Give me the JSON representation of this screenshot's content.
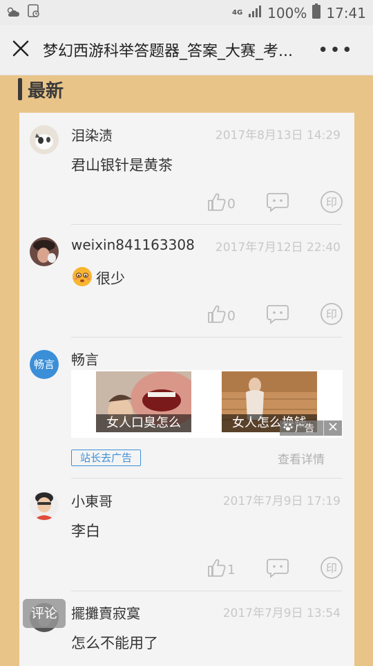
{
  "status_bar": {
    "network": "4G",
    "battery": "100%",
    "time": "17:41"
  },
  "navbar": {
    "title": "梦幻西游科举答题器_答案_大赛_考...",
    "more_label": "•••"
  },
  "section": {
    "title": "最新"
  },
  "comments": [
    {
      "username": "泪染渍",
      "time": "2017年8月13日 14:29",
      "text": "君山银针是黄茶",
      "likes": "0",
      "emoji": false
    },
    {
      "username": "weixin841163308",
      "time": "2017年7月12日 22:40",
      "text": "很少",
      "likes": "0",
      "emoji": true
    },
    {
      "username": "小東哥",
      "time": "2017年7月9日 17:19",
      "text": "李白",
      "likes": "1",
      "emoji": false
    },
    {
      "username": "擺攤賣寂寞",
      "time": "2017年7月9日 13:54",
      "text": "怎么不能用了"
    }
  ],
  "ad": {
    "advertiser": "畅言",
    "avatar_text": "畅言",
    "captions": [
      "女人口臭怎么",
      "女人怎么换钱"
    ],
    "tag": "广告",
    "chip": "站长去广告",
    "detail": "查看详情"
  },
  "float_button": {
    "label": "评论"
  },
  "colors": {
    "page_background": "#e9c488",
    "accent_blue": "#3b8fd8"
  }
}
